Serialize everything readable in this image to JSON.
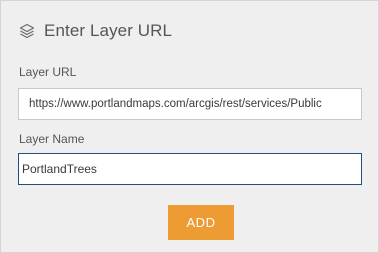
{
  "header": {
    "icon": "layers-icon",
    "title": "Enter Layer URL"
  },
  "form": {
    "layer_url": {
      "label": "Layer URL",
      "value": "https://www.portlandmaps.com/arcgis/rest/services/Public"
    },
    "layer_name": {
      "label": "Layer Name",
      "value": "PortlandTrees"
    },
    "add_button": "ADD"
  },
  "colors": {
    "panel_background": "#efefef",
    "accent_button": "#ed9b33",
    "focused_input_border": "#1f4f82"
  }
}
